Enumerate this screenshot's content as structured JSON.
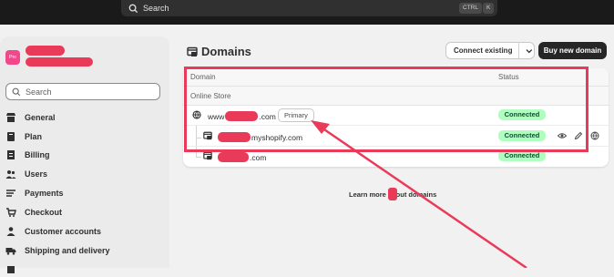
{
  "topbar": {
    "search_placeholder": "Search",
    "shortcut_1": "CTRL",
    "shortcut_2": "K"
  },
  "sidebar": {
    "store_badge": "Pro",
    "search_placeholder": "Search",
    "items": [
      {
        "label": "General",
        "icon": "store-icon"
      },
      {
        "label": "Plan",
        "icon": "plan-icon"
      },
      {
        "label": "Billing",
        "icon": "billing-icon"
      },
      {
        "label": "Users",
        "icon": "users-icon"
      },
      {
        "label": "Payments",
        "icon": "payments-icon"
      },
      {
        "label": "Checkout",
        "icon": "cart-icon"
      },
      {
        "label": "Customer accounts",
        "icon": "person-icon"
      },
      {
        "label": "Shipping and delivery",
        "icon": "truck-icon"
      }
    ]
  },
  "page": {
    "title": "Domains",
    "connect_button": "Connect existing",
    "buy_button": "Buy new domain",
    "columns": {
      "domain": "Domain",
      "status": "Status"
    },
    "group_label": "Online Store",
    "rows": [
      {
        "prefix": "www",
        "suffix": ".com",
        "badge": "Primary",
        "status": "Connected"
      },
      {
        "prefix": "",
        "suffix": "myshopify.com",
        "status": "Connected"
      },
      {
        "prefix": "",
        "suffix": ".com",
        "status": "Connected"
      }
    ],
    "learn_more": "Learn more about domains"
  },
  "colors": {
    "annotation": "#ea3a5a",
    "connected_bg": "#affebf",
    "connected_text": "#0c5132"
  }
}
